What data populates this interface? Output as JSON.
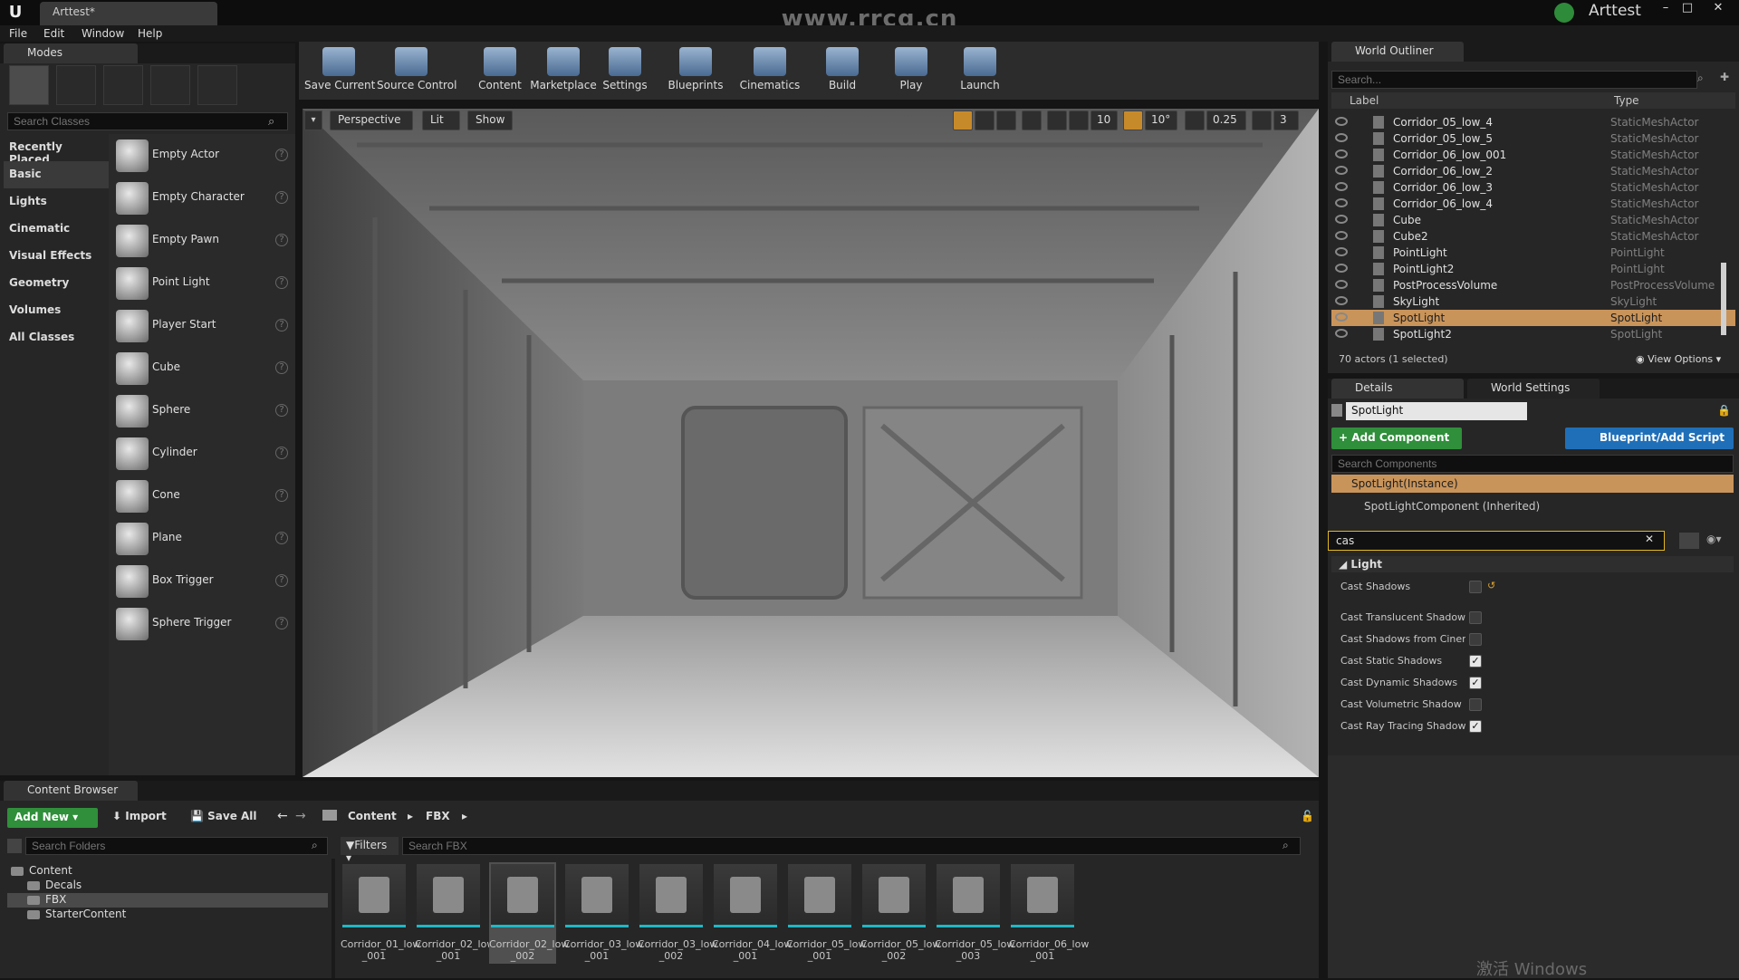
{
  "window": {
    "project_tab": "Arttest*",
    "watermark": "www.rrcg.cn",
    "user": "Arttest",
    "minimize": "–",
    "maximize": "□",
    "close": "✕"
  },
  "menu": [
    "File",
    "Edit",
    "Window",
    "Help"
  ],
  "modes": {
    "tab": "Modes",
    "search_placeholder": "Search Classes",
    "mode_icons": [
      "place-mode-icon",
      "paint-mode-icon",
      "landscape-mode-icon",
      "foliage-mode-icon",
      "geometry-mode-icon"
    ],
    "categories": [
      "Recently Placed",
      "Basic",
      "Lights",
      "Cinematic",
      "Visual Effects",
      "Geometry",
      "Volumes",
      "All Classes"
    ],
    "active_category": "Basic",
    "items": [
      "Empty Actor",
      "Empty Character",
      "Empty Pawn",
      "Point Light",
      "Player Start",
      "Cube",
      "Sphere",
      "Cylinder",
      "Cone",
      "Plane",
      "Box Trigger",
      "Sphere Trigger"
    ]
  },
  "toolbar": [
    "Save Current",
    "Source Control",
    "Content",
    "Marketplace",
    "Settings",
    "Blueprints",
    "Cinematics",
    "Build",
    "Play",
    "Launch"
  ],
  "viewport": {
    "perspective": "Perspective",
    "lit": "Lit",
    "show": "Show",
    "grid_snap": "10",
    "rot_snap": "10°",
    "scale_snap": "0.25",
    "camera_speed": "3"
  },
  "outliner": {
    "tab": "World Outliner",
    "search_placeholder": "Search...",
    "col_label": "Label",
    "col_type": "Type",
    "rows": [
      {
        "label": "Corridor_05_low_4",
        "type": "StaticMeshActor"
      },
      {
        "label": "Corridor_05_low_5",
        "type": "StaticMeshActor"
      },
      {
        "label": "Corridor_06_low_001",
        "type": "StaticMeshActor"
      },
      {
        "label": "Corridor_06_low_2",
        "type": "StaticMeshActor"
      },
      {
        "label": "Corridor_06_low_3",
        "type": "StaticMeshActor"
      },
      {
        "label": "Corridor_06_low_4",
        "type": "StaticMeshActor"
      },
      {
        "label": "Cube",
        "type": "StaticMeshActor"
      },
      {
        "label": "Cube2",
        "type": "StaticMeshActor"
      },
      {
        "label": "PointLight",
        "type": "PointLight"
      },
      {
        "label": "PointLight2",
        "type": "PointLight"
      },
      {
        "label": "PostProcessVolume",
        "type": "PostProcessVolume"
      },
      {
        "label": "SkyLight",
        "type": "SkyLight"
      },
      {
        "label": "SpotLight",
        "type": "SpotLight"
      },
      {
        "label": "SpotLight2",
        "type": "SpotLight"
      }
    ],
    "selected_index": 12,
    "status": "70 actors (1 selected)",
    "view_options": "View Options"
  },
  "details": {
    "tab_details": "Details",
    "tab_world": "World Settings",
    "actor_name": "SpotLight",
    "add_component": "+ Add Component",
    "blueprint_script": "Blueprint/Add Script",
    "search_components_placeholder": "Search Components",
    "instance": "SpotLight(Instance)",
    "component": "SpotLightComponent (Inherited)",
    "filter_value": "cas",
    "section": "Light",
    "properties": [
      {
        "label": "Cast Shadows",
        "checked": false
      },
      {
        "label": "Cast Translucent Shadows",
        "checked": false
      },
      {
        "label": "Cast Shadows from Cinematic Objects Only",
        "checked": false
      },
      {
        "label": "Cast Static Shadows",
        "checked": true
      },
      {
        "label": "Cast Dynamic Shadows",
        "checked": true
      },
      {
        "label": "Cast Volumetric Shadow",
        "checked": false
      },
      {
        "label": "Cast Ray Tracing Shadow",
        "checked": true
      }
    ]
  },
  "content_browser": {
    "tab": "Content Browser",
    "add_new": "Add New",
    "import": "Import",
    "save_all": "Save All",
    "path": [
      "Content",
      "FBX"
    ],
    "search_folders_placeholder": "Search Folders",
    "filters": "Filters",
    "search_placeholder": "Search FBX",
    "folders": [
      {
        "name": "Content",
        "level": 0
      },
      {
        "name": "Decals",
        "level": 1
      },
      {
        "name": "FBX",
        "level": 1,
        "selected": true
      },
      {
        "name": "StarterContent",
        "level": 1
      }
    ],
    "assets": [
      "Corridor_01_low\n_001",
      "Corridor_02_low\n_001",
      "Corridor_02_low\n_002",
      "Corridor_03_low\n_001",
      "Corridor_03_low\n_002",
      "Corridor_04_low\n_001",
      "Corridor_05_low\n_001",
      "Corridor_05_low\n_002",
      "Corridor_05_low\n_003",
      "Corridor_06_low\n_001"
    ],
    "selected_asset": 2
  },
  "windows_watermark": "激活 Windows"
}
